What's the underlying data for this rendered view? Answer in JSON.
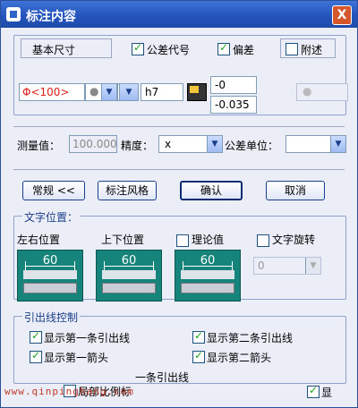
{
  "window": {
    "title": "标注内容",
    "close": "X"
  },
  "top_options": {
    "basic_size": "基本尺寸",
    "tolerance_code": "公差代号",
    "deviation": "偏差",
    "remark": "附述"
  },
  "value_row": {
    "main_value": "Φ<100>",
    "fit_code": "h7",
    "upper_dev": "-0",
    "lower_dev": "-0.035"
  },
  "measure_row": {
    "measured_label": "测量值：",
    "measured_value": "100.000",
    "precision_label": "精度：",
    "precision_value": "x",
    "tol_unit_label": "公差单位："
  },
  "buttons": {
    "normal": "常规 <<",
    "style": "标注风格",
    "ok": "确认",
    "cancel": "取消"
  },
  "text_pos": {
    "title": "文字位置：",
    "lr": "左右位置",
    "ud": "上下位置",
    "theory": "理论值",
    "rotate": "文字旋转",
    "preview_value": "60",
    "rotate_value": "0"
  },
  "leader": {
    "title": "引出线控制",
    "show_first_leader": "显示第一条引出线",
    "show_second_leader": "显示第二条引出线",
    "show_first_arrow": "显示第一箭头",
    "show_second_arrow": "显示第二箭头",
    "partial": "局部比例标",
    "overlap_text": "一条引出线",
    "show_right": "显"
  },
  "watermark": "www.qinpinghang.com"
}
